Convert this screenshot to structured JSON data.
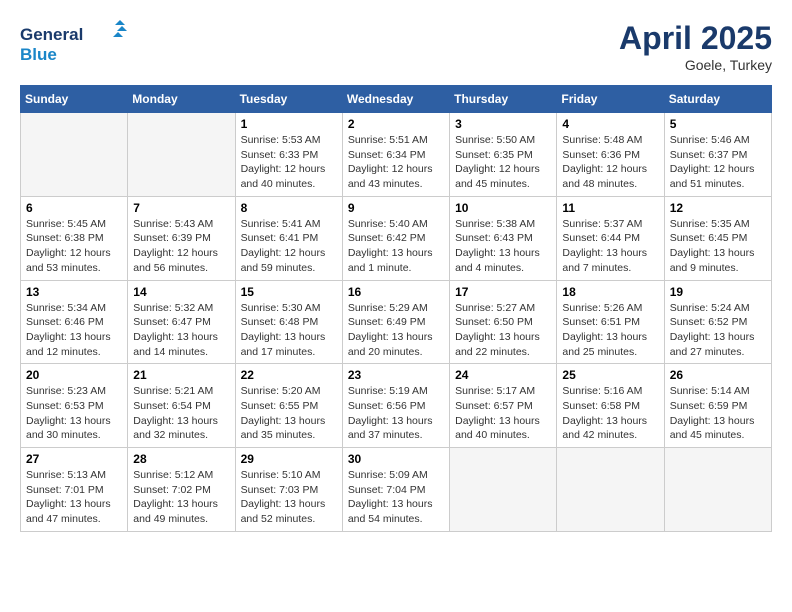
{
  "header": {
    "logo_line1": "General",
    "logo_line2": "Blue",
    "month_year": "April 2025",
    "location": "Goele, Turkey"
  },
  "days_of_week": [
    "Sunday",
    "Monday",
    "Tuesday",
    "Wednesday",
    "Thursday",
    "Friday",
    "Saturday"
  ],
  "weeks": [
    [
      {
        "day": "",
        "info": ""
      },
      {
        "day": "",
        "info": ""
      },
      {
        "day": "1",
        "info": "Sunrise: 5:53 AM\nSunset: 6:33 PM\nDaylight: 12 hours and 40 minutes."
      },
      {
        "day": "2",
        "info": "Sunrise: 5:51 AM\nSunset: 6:34 PM\nDaylight: 12 hours and 43 minutes."
      },
      {
        "day": "3",
        "info": "Sunrise: 5:50 AM\nSunset: 6:35 PM\nDaylight: 12 hours and 45 minutes."
      },
      {
        "day": "4",
        "info": "Sunrise: 5:48 AM\nSunset: 6:36 PM\nDaylight: 12 hours and 48 minutes."
      },
      {
        "day": "5",
        "info": "Sunrise: 5:46 AM\nSunset: 6:37 PM\nDaylight: 12 hours and 51 minutes."
      }
    ],
    [
      {
        "day": "6",
        "info": "Sunrise: 5:45 AM\nSunset: 6:38 PM\nDaylight: 12 hours and 53 minutes."
      },
      {
        "day": "7",
        "info": "Sunrise: 5:43 AM\nSunset: 6:39 PM\nDaylight: 12 hours and 56 minutes."
      },
      {
        "day": "8",
        "info": "Sunrise: 5:41 AM\nSunset: 6:41 PM\nDaylight: 12 hours and 59 minutes."
      },
      {
        "day": "9",
        "info": "Sunrise: 5:40 AM\nSunset: 6:42 PM\nDaylight: 13 hours and 1 minute."
      },
      {
        "day": "10",
        "info": "Sunrise: 5:38 AM\nSunset: 6:43 PM\nDaylight: 13 hours and 4 minutes."
      },
      {
        "day": "11",
        "info": "Sunrise: 5:37 AM\nSunset: 6:44 PM\nDaylight: 13 hours and 7 minutes."
      },
      {
        "day": "12",
        "info": "Sunrise: 5:35 AM\nSunset: 6:45 PM\nDaylight: 13 hours and 9 minutes."
      }
    ],
    [
      {
        "day": "13",
        "info": "Sunrise: 5:34 AM\nSunset: 6:46 PM\nDaylight: 13 hours and 12 minutes."
      },
      {
        "day": "14",
        "info": "Sunrise: 5:32 AM\nSunset: 6:47 PM\nDaylight: 13 hours and 14 minutes."
      },
      {
        "day": "15",
        "info": "Sunrise: 5:30 AM\nSunset: 6:48 PM\nDaylight: 13 hours and 17 minutes."
      },
      {
        "day": "16",
        "info": "Sunrise: 5:29 AM\nSunset: 6:49 PM\nDaylight: 13 hours and 20 minutes."
      },
      {
        "day": "17",
        "info": "Sunrise: 5:27 AM\nSunset: 6:50 PM\nDaylight: 13 hours and 22 minutes."
      },
      {
        "day": "18",
        "info": "Sunrise: 5:26 AM\nSunset: 6:51 PM\nDaylight: 13 hours and 25 minutes."
      },
      {
        "day": "19",
        "info": "Sunrise: 5:24 AM\nSunset: 6:52 PM\nDaylight: 13 hours and 27 minutes."
      }
    ],
    [
      {
        "day": "20",
        "info": "Sunrise: 5:23 AM\nSunset: 6:53 PM\nDaylight: 13 hours and 30 minutes."
      },
      {
        "day": "21",
        "info": "Sunrise: 5:21 AM\nSunset: 6:54 PM\nDaylight: 13 hours and 32 minutes."
      },
      {
        "day": "22",
        "info": "Sunrise: 5:20 AM\nSunset: 6:55 PM\nDaylight: 13 hours and 35 minutes."
      },
      {
        "day": "23",
        "info": "Sunrise: 5:19 AM\nSunset: 6:56 PM\nDaylight: 13 hours and 37 minutes."
      },
      {
        "day": "24",
        "info": "Sunrise: 5:17 AM\nSunset: 6:57 PM\nDaylight: 13 hours and 40 minutes."
      },
      {
        "day": "25",
        "info": "Sunrise: 5:16 AM\nSunset: 6:58 PM\nDaylight: 13 hours and 42 minutes."
      },
      {
        "day": "26",
        "info": "Sunrise: 5:14 AM\nSunset: 6:59 PM\nDaylight: 13 hours and 45 minutes."
      }
    ],
    [
      {
        "day": "27",
        "info": "Sunrise: 5:13 AM\nSunset: 7:01 PM\nDaylight: 13 hours and 47 minutes."
      },
      {
        "day": "28",
        "info": "Sunrise: 5:12 AM\nSunset: 7:02 PM\nDaylight: 13 hours and 49 minutes."
      },
      {
        "day": "29",
        "info": "Sunrise: 5:10 AM\nSunset: 7:03 PM\nDaylight: 13 hours and 52 minutes."
      },
      {
        "day": "30",
        "info": "Sunrise: 5:09 AM\nSunset: 7:04 PM\nDaylight: 13 hours and 54 minutes."
      },
      {
        "day": "",
        "info": ""
      },
      {
        "day": "",
        "info": ""
      },
      {
        "day": "",
        "info": ""
      }
    ]
  ]
}
